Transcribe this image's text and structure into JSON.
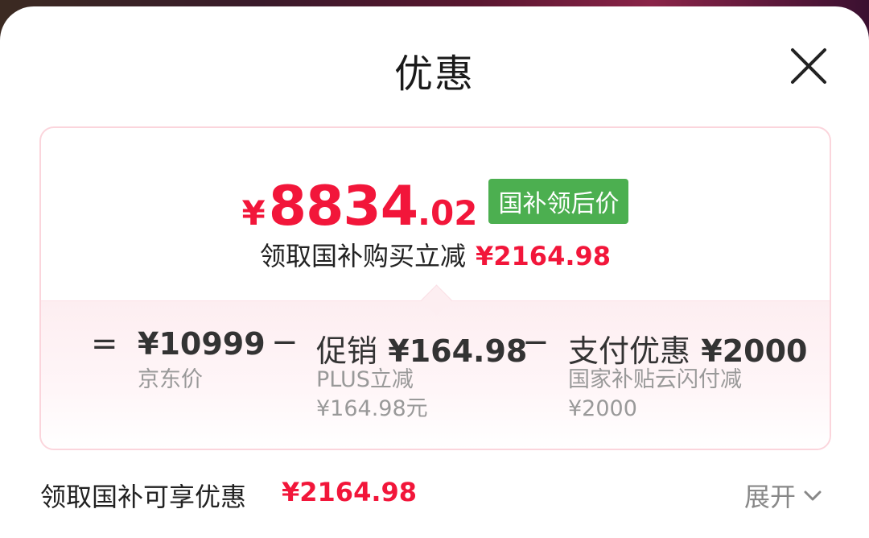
{
  "header": {
    "title": "优惠"
  },
  "summary": {
    "currency": "¥",
    "price_int": "8834",
    "price_dec": ".02",
    "badge": "国补领后价",
    "save_text": "领取国补购买立减",
    "save_amount": "¥2164.98"
  },
  "breakdown": {
    "eq": "=",
    "minus": "−",
    "jd_price": {
      "amount": "¥10999",
      "label": "京东价"
    },
    "promo": {
      "title": "促销",
      "amount": "¥164.98",
      "line1": "PLUS立减",
      "line2": "¥164.98元"
    },
    "payment": {
      "title": "支付优惠",
      "amount": "¥2000",
      "line1": "国家补贴云闪付减",
      "line2": "¥2000"
    }
  },
  "footer": {
    "label": "领取国补可享优惠",
    "amount": "¥2164.98",
    "expand_label": "展开"
  },
  "colors": {
    "accent_red": "#f2163a",
    "badge_green": "#4caf50",
    "card_border": "#fbd5dc"
  },
  "icons": {
    "close": "close-icon",
    "expand": "chevron-down-icon"
  }
}
